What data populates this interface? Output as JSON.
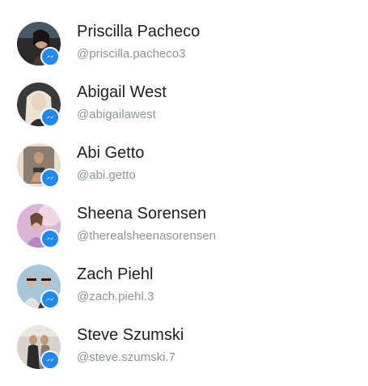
{
  "contacts": [
    {
      "name": "Priscilla Pacheco",
      "handle": "@priscilla.pacheco3",
      "badge_icon": "messenger-icon",
      "photo": {
        "bg": "#2a2a2a",
        "accent": "#c9a27e",
        "accent2": "#5c7a8c"
      }
    },
    {
      "name": "Abigail West",
      "handle": "@abigailawest",
      "badge_icon": "messenger-icon",
      "photo": {
        "bg": "#3a3a3a",
        "accent": "#e8dccb",
        "accent2": "#f2e6d6"
      }
    },
    {
      "name": "Abi Getto",
      "handle": "@abi.getto",
      "badge_icon": "messenger-icon",
      "photo": {
        "bg": "#8a7e70",
        "accent": "#c59a7a",
        "accent2": "#e7dccd"
      }
    },
    {
      "name": "Sheena Sorensen",
      "handle": "@therealsheenasorensen",
      "badge_icon": "messenger-icon",
      "photo": {
        "bg": "#d9b6d8",
        "accent": "#b58ac4",
        "accent2": "#f0d6e2"
      }
    },
    {
      "name": "Zach Piehl",
      "handle": "@zach.piehl.3",
      "badge_icon": "messenger-icon",
      "photo": {
        "bg": "#a7c6d9",
        "accent": "#3b3b3b",
        "accent2": "#e2e2e2"
      }
    },
    {
      "name": "Steve Szumski",
      "handle": "@steve.szumski.7",
      "badge_icon": "messenger-icon",
      "photo": {
        "bg": "#d8d4cc",
        "accent": "#2b2b2b",
        "accent2": "#8a7b6a"
      }
    }
  ],
  "colors": {
    "badge": "#1e88f5",
    "name_text": "#1c1e21",
    "handle_text": "#8d949e"
  }
}
